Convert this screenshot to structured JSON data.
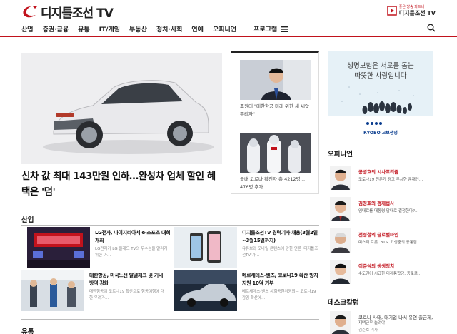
{
  "brand": {
    "logo_text": "디지틀조선 TV",
    "tv_slogan": "좋은 방송 파트너",
    "tv_name": "디지틀조선 TV",
    "accent": "#c1121c"
  },
  "nav": {
    "items": [
      "산업",
      "증권·금융",
      "유통",
      "IT/게임",
      "부동산",
      "정치·사회",
      "연예",
      "오피니언"
    ],
    "program_label": "프로그램"
  },
  "hero": {
    "headline": "신차 값 최대 143만원 인하…완성차 업체 할인 혜택은 '덤'"
  },
  "side_news": [
    {
      "text": "조원태 \"대한항공 미래 위한 새 씨앗 뿌리자\""
    },
    {
      "text": "국내 코로나 확진자 총 4212명…476명 추가"
    }
  ],
  "ad": {
    "line1": "생명보험은 서로를 돕는",
    "line2": "따뜻한 사랑입니다",
    "brand": "KYOBO 교보생명"
  },
  "sections": {
    "industry": "산업",
    "distribution": "유통",
    "opinion": "오피니언",
    "desk": "데스크칼럼"
  },
  "industry_news": [
    {
      "title": "LG전자, 나이지리아서 e-스포츠 대회 개최",
      "desc": "LG전자가 LG 올레드 TV의 우수성을 알리기 위한 아…"
    },
    {
      "title": "디지틀조선TV 경력기자 채용(3월2일~3월15일까지)",
      "desc": "유튜브와 모바일 콘텐츠에 강한 언론 '디지틀조선TV'가…"
    },
    {
      "title": "대한항공, 미국노선 발열체크 및 기내방역 강화",
      "desc": "대한항공이 코로나19 확산으로 항공여행에 대한 우려가…"
    },
    {
      "title": "메르세데스-벤츠, 코로나19 확산 방지 지원 10억 기부",
      "desc": "메르세데스-벤츠 사회공헌위원회는 코로나19 감염 확산에…"
    }
  ],
  "opinion": [
    {
      "name": "공병호의 시사프리즘",
      "desc": "코로나19 전문가 경고 무시한 문재인…"
    },
    {
      "name": "김정호의 경제법사",
      "desc": "임대료를 대통령 맘대로 결정한다?…"
    },
    {
      "name": "전성철의 글로벌마인",
      "desc": "미스터 트롯, BTS, 기생충의 공통점"
    },
    {
      "name": "이준석의 생생정치",
      "desc": "수도권이 시급한 미래통합당, 종로로…"
    }
  ],
  "desk": [
    {
      "name": "코로나 사태, 대기업 나서 유연 출근제,",
      "desc": "재택근무 늘려야"
    },
    {
      "name": "김준호 기자",
      "desc": ""
    }
  ]
}
